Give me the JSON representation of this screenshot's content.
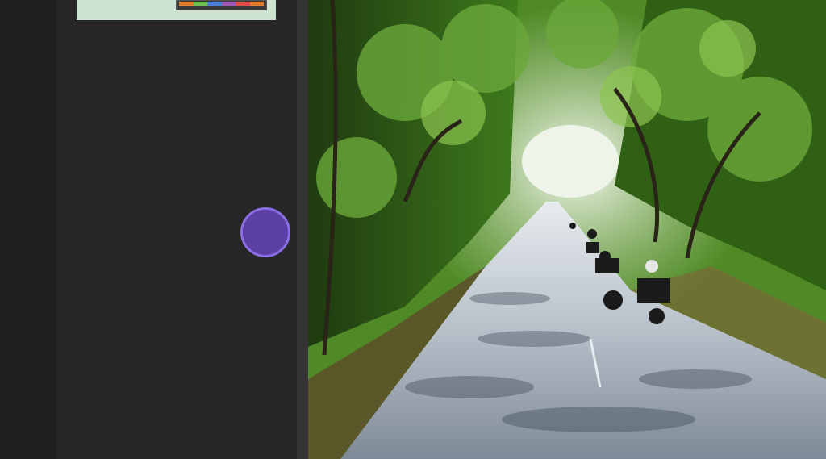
{
  "thumbnail": {
    "swatch_colors": [
      "#e07b2e",
      "#6bbf4e",
      "#4a7fd6",
      "#9b59b6",
      "#e04b4b",
      "#e07b2e"
    ]
  },
  "record_button": {
    "icon": "circle-record-icon",
    "color": "#5b3fa3",
    "ring": "#8b6ee6"
  },
  "video": {
    "scene": "tree-canopy-road-with-trikes",
    "colors": {
      "sky": "#e8f0e6",
      "road": "#a9b4c0",
      "foliage": "#3f7a1f"
    }
  }
}
